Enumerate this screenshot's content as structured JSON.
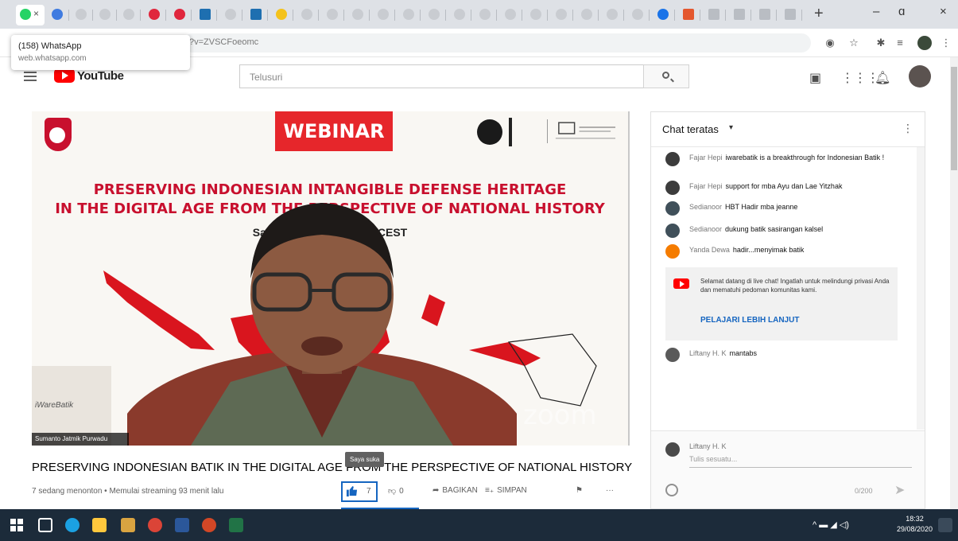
{
  "browser": {
    "tab_close": "×",
    "new_tab": "+",
    "minimize": "–",
    "restore": "ɑ",
    "close": "×",
    "tooltip": {
      "title": "(158) WhatsApp",
      "url": "web.whatsapp.com"
    },
    "address": "?v=ZVSCFoeomc"
  },
  "masthead": {
    "logo_text": "YouTube",
    "search_placeholder": "Telusuri"
  },
  "video": {
    "banner_label": "WEBINAR",
    "headline_1": "PRESERVING INDONESIAN INTANGIBLE DEFENSE HERITAGE",
    "headline_2": "IN THE DIGITAL AGE FROM THE PERSPECTIVE OF NATIONAL HISTORY",
    "dateline": "Saturday 27 ... WIB / 10 CEST",
    "pip_text": "iWareBatik",
    "pip_label": "Sumanto Jatmik Purwadu",
    "watermark": "zoom"
  },
  "below_video": {
    "title": "PRESERVING INDONESIAN BATIK IN THE DIGITAL AGE FROM THE PERSPECTIVE OF NATIONAL HISTORY",
    "meta": "7 sedang menonton • Memulai streaming 93 menit lalu",
    "like_count": "7",
    "dislike_count": "0",
    "share_label": "BAGIKAN",
    "save_label": "SIMPAN",
    "more_label": "···",
    "like_tooltip": "Saya suka"
  },
  "chat": {
    "header": "Chat teratas",
    "caret": "▾",
    "more": "⋮",
    "messages": [
      {
        "author": "Fajar Hepi",
        "text": "iwarebatik is a breakthrough for Indonesian Batik !"
      },
      {
        "author": "Fajar Hepi",
        "text": "support for mba Ayu dan Lae Yitzhak"
      },
      {
        "author": "Sedianoor",
        "text": "HBT Hadir mba jeanne"
      },
      {
        "author": "Sedianoor",
        "text": "dukung batik sasirangan kalsel"
      },
      {
        "author": "Yanda Dewa",
        "text": "hadir...menyimak batik"
      }
    ],
    "notice_text": "Selamat datang di live chat! Ingatlah untuk melindungi privasi Anda dan mematuhi pedoman komunitas kami.",
    "notice_link": "PELAJARI LEBIH LANJUT",
    "last_message": {
      "author": "Liftany H. K",
      "text": "mantabs"
    },
    "input_name": "Liftany H. K",
    "input_placeholder": "Tulis sesuatu...",
    "char_count": "0/200",
    "send": "➤"
  },
  "taskbar": {
    "time": "18:32",
    "date": "29/08/2020",
    "tray_text": "^ ▬ ◢ ◁)"
  },
  "colors": {
    "accent_blue": "#1565c0",
    "youtube_red": "#ff0000",
    "banner_red": "#e6262b",
    "taskbar": "#1c2b3a"
  }
}
